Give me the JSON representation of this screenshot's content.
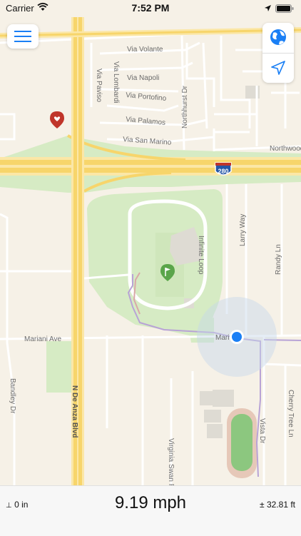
{
  "status_bar": {
    "carrier": "Carrier",
    "time": "7:52 PM"
  },
  "map": {
    "street_labels": [
      "Via Volante",
      "Via Lombardi",
      "Via Napoli",
      "Via Paviso",
      "Via Portofino",
      "Via Palamos",
      "Via San Marino",
      "Northhurst Dr",
      "Northwood",
      "280",
      "Infinite Loop",
      "Larry Way",
      "Randy Ln",
      "Mariani Ave",
      "Mari",
      "Bandley Dr",
      "N De Anza Blvd",
      "Virginia Swan Pl",
      "Vista Dr",
      "Cherry Tree Ln"
    ]
  },
  "buttons": {
    "menu_icon": "hamburger-menu-icon",
    "globe_icon": "globe-icon",
    "locate_icon": "location-arrow-icon"
  },
  "bottom_bar": {
    "altitude": "0 in",
    "speed": "9.19 mph",
    "accuracy": "± 32.81 ft"
  },
  "colors": {
    "map_background": "#f6f1e7",
    "park_green": "#d6ebc4",
    "highway_yellow": "#f7d56b",
    "user_location_blue": "#1a7ff5",
    "track_purple": "#b8a3d6",
    "pin_red": "#c0352a",
    "pin_green": "#5aa54a"
  }
}
